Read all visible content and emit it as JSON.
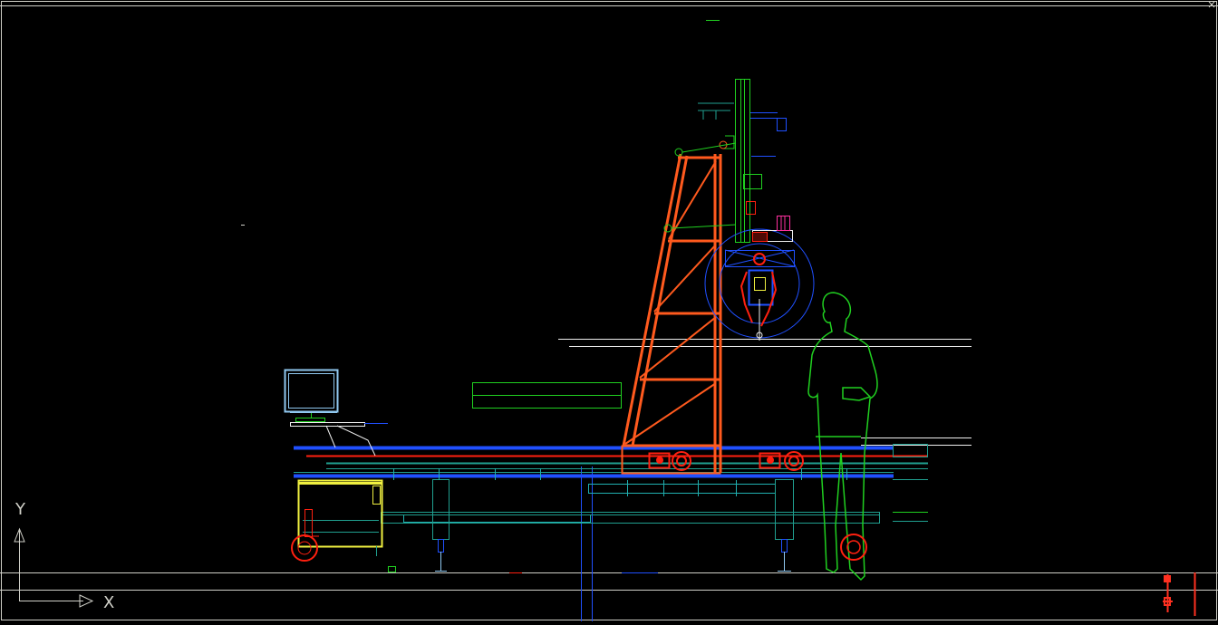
{
  "ucs": {
    "y_label": "Y",
    "x_label": "X"
  },
  "colors": {
    "background": "#000000",
    "frame": "#d0d0c8",
    "frame_red": "#ff3020",
    "blue": "#2050ff",
    "red": "#ff2010",
    "orange": "#ff5a1e",
    "green": "#20d020",
    "cyan": "#20b0b0",
    "teal": "#20a090",
    "yellow": "#f0f040",
    "white": "#f0f0f0",
    "magenta": "#ff30a0",
    "light_blue": "#90c8f0"
  },
  "icons": {
    "ucs": "ucs-axes-icon",
    "monitor": "computer-monitor-icon",
    "person": "human-figure-icon"
  }
}
